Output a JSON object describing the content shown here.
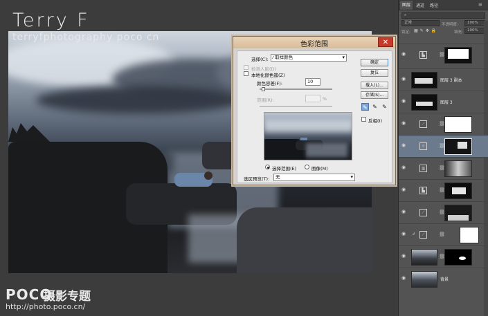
{
  "watermark": {
    "title": "Terry F",
    "subtitle": "terryfphotography poco cn",
    "logo": "POCO",
    "logo_cn": "摄影专题",
    "url": "http://photo.poco.cn/"
  },
  "dialog": {
    "title": "色彩范围",
    "close_label": "✕",
    "select_label": "选择(C):",
    "select_value": "取样颜色",
    "detect_faces_label": "检测人脸(D)",
    "localized_label": "本地化颜色簇(Z)",
    "fuzziness_label": "颜色容差(F):",
    "fuzziness_value": "10",
    "range_label": "范围(R):",
    "range_value": "%",
    "radio_selection_label": "选择范围(E)",
    "radio_image_label": "图像(M)",
    "preview_label": "选区预览(T):",
    "preview_value": "无",
    "ok_label": "确定",
    "reset_label": "复位",
    "load_label": "载入(L)...",
    "save_label": "存储(S)...",
    "invert_label": "反相(I)",
    "eyedroppers": [
      "eyedropper",
      "eyedropper-plus",
      "eyedropper-minus"
    ]
  },
  "panel": {
    "tabs": [
      "图层",
      "通道",
      "路径"
    ],
    "blend_mode": "正常",
    "opacity_label": "不透明度:",
    "opacity_value": "100%",
    "lock_label": "锁定:",
    "fill_label": "填充:",
    "fill_value": "100%",
    "layers": [
      {
        "name": "",
        "type": "levels",
        "active": false
      },
      {
        "name": "图层 3 副本",
        "type": "image",
        "active": false
      },
      {
        "name": "图层 3",
        "type": "image",
        "active": false
      },
      {
        "name": "",
        "type": "curves",
        "active": false
      },
      {
        "name": "",
        "type": "brightness",
        "active": true
      },
      {
        "name": "",
        "type": "hue",
        "active": false
      },
      {
        "name": "",
        "type": "levels",
        "active": false
      },
      {
        "name": "",
        "type": "curves",
        "active": false
      },
      {
        "name": "",
        "type": "curves",
        "active": false
      },
      {
        "name": "",
        "type": "image-mask",
        "active": false
      },
      {
        "name": "背景",
        "type": "image",
        "active": false
      }
    ]
  }
}
